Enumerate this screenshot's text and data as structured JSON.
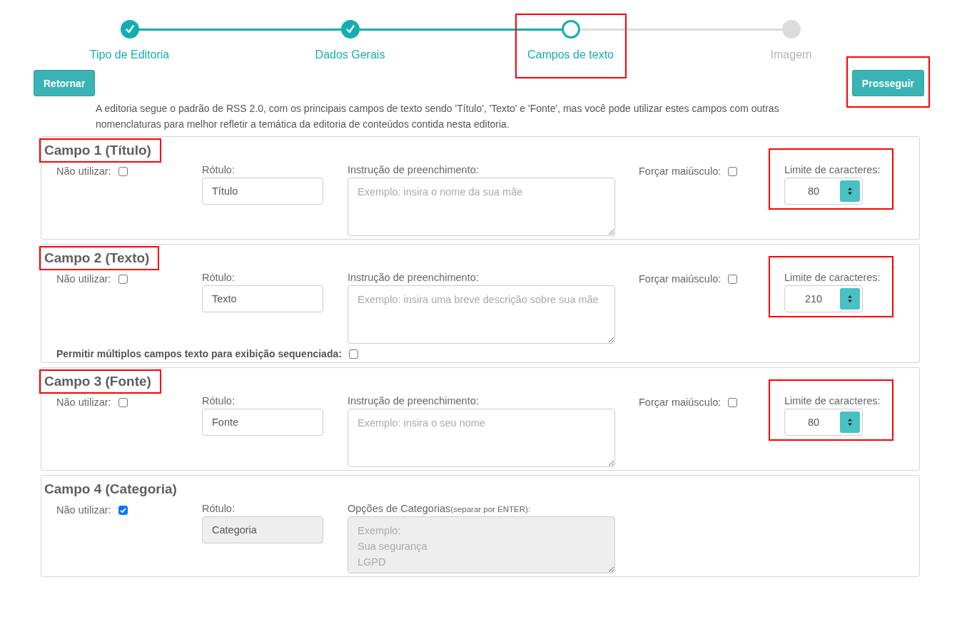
{
  "steps": [
    {
      "label": "Tipo de Editoria",
      "completed": true,
      "selected": false,
      "highlighted": false
    },
    {
      "label": "Dados Gerais",
      "completed": true,
      "selected": false,
      "highlighted": false
    },
    {
      "label": "Campos de texto",
      "completed": false,
      "selected": true,
      "highlighted": true
    },
    {
      "label": "Imagem",
      "completed": false,
      "selected": false,
      "highlighted": false
    }
  ],
  "buttons": [
    {
      "label": "Retornar",
      "kind": "back",
      "highlighted": false
    },
    {
      "label": "Prosseguir",
      "kind": "next",
      "highlighted": true
    }
  ],
  "intro": "A editoria segue o padrão de RSS 2.0, com os principais campos de texto sendo 'Título', 'Texto' e 'Fonte', mas você pode utilizar estes campos com outras nomenclaturas para melhor refletir a temática da editoria de conteúdos contida nesta editoria.",
  "fields": [
    {
      "title": "Campo 1 (Título)",
      "title_highlighted": true,
      "skip": {
        "label": "Não utilizar:",
        "checked": false
      },
      "name": {
        "label": "Rótulo:",
        "value": "Título",
        "disabled": false
      },
      "instruction": {
        "label": "Instrução de preenchimento:",
        "placeholder": "Exemplo: insira o nome da sua mãe",
        "disabled": false
      },
      "uppercase": {
        "label": "Forçar maiúsculo:",
        "checked": false
      },
      "limit": {
        "label": "Limite de caracteres:",
        "value": "80",
        "highlighted": true
      }
    },
    {
      "title": "Campo 2 (Texto)",
      "title_highlighted": true,
      "skip": {
        "label": "Não utilizar:",
        "checked": false
      },
      "name": {
        "label": "Rótulo:",
        "value": "Texto",
        "disabled": false
      },
      "instruction": {
        "label": "Instrução de preenchimento:",
        "placeholder": "Exemplo: insira uma breve descrição sobre sua mãe",
        "disabled": false
      },
      "uppercase": {
        "label": "Forçar maiúsculo:",
        "checked": false
      },
      "limit": {
        "label": "Limite de caracteres:",
        "value": "210",
        "highlighted": true
      },
      "multiple": {
        "label": "Permitir múltiplos campos texto para exibição sequenciada:",
        "checked": false
      }
    },
    {
      "title": "Campo 3 (Fonte)",
      "title_highlighted": true,
      "skip": {
        "label": "Não utilizar:",
        "checked": false
      },
      "name": {
        "label": "Rótulo:",
        "value": "Fonte",
        "disabled": false
      },
      "instruction": {
        "label": "Instrução de preenchimento:",
        "placeholder": "Exemplo: insira o seu nome",
        "disabled": false
      },
      "uppercase": {
        "label": "Forçar maiúsculo:",
        "checked": false
      },
      "limit": {
        "label": "Limite de caracteres:",
        "value": "80",
        "highlighted": true
      }
    },
    {
      "title": "Campo 4 (Categoria)",
      "title_highlighted": false,
      "skip": {
        "label": "Não utilizar:",
        "checked": true
      },
      "name": {
        "label": "Rótulo:",
        "value": "Categoria",
        "disabled": true
      },
      "instruction": {
        "label": "Opções de Categorias",
        "hint": "(separar por ENTER):",
        "placeholder": "Exemplo:\nSua segurança\nLGPD",
        "disabled": true
      }
    }
  ]
}
